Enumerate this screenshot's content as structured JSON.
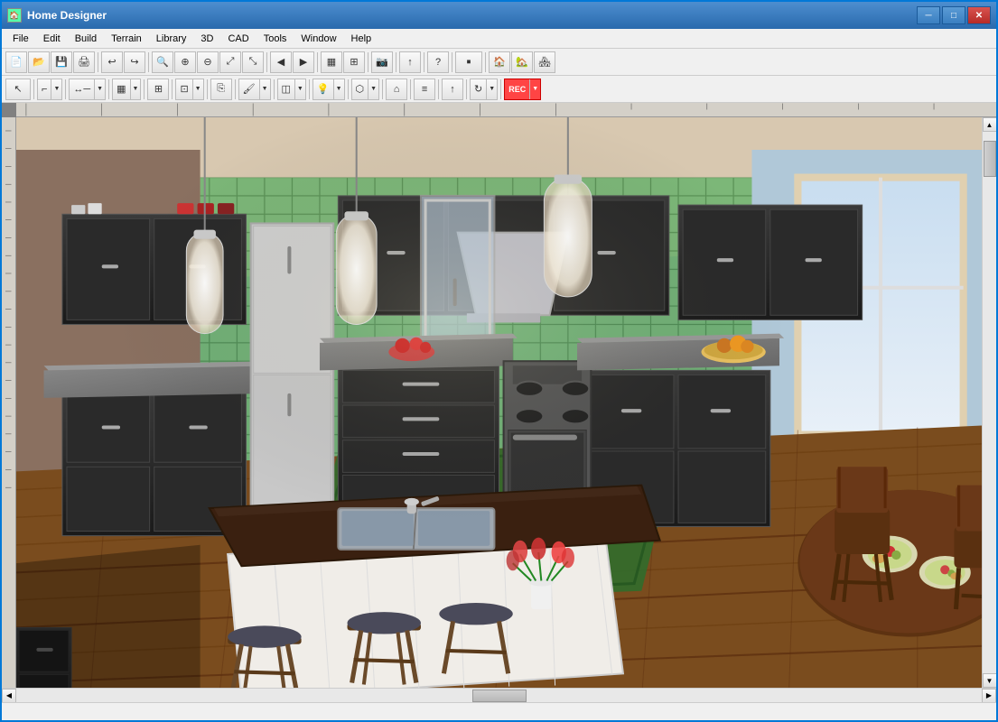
{
  "window": {
    "title": "Home Designer",
    "icon": "🏠"
  },
  "titlebar": {
    "controls": {
      "minimize": "─",
      "maximize": "□",
      "close": "✕"
    }
  },
  "menubar": {
    "items": [
      {
        "id": "file",
        "label": "File"
      },
      {
        "id": "edit",
        "label": "Edit"
      },
      {
        "id": "build",
        "label": "Build"
      },
      {
        "id": "terrain",
        "label": "Terrain"
      },
      {
        "id": "library",
        "label": "Library"
      },
      {
        "id": "3d",
        "label": "3D"
      },
      {
        "id": "cad",
        "label": "CAD"
      },
      {
        "id": "tools",
        "label": "Tools"
      },
      {
        "id": "window",
        "label": "Window"
      },
      {
        "id": "help",
        "label": "Help"
      }
    ]
  },
  "toolbar1": {
    "buttons": [
      {
        "id": "new",
        "icon": "📄",
        "tooltip": "New"
      },
      {
        "id": "open",
        "icon": "📂",
        "tooltip": "Open"
      },
      {
        "id": "save",
        "icon": "💾",
        "tooltip": "Save"
      },
      {
        "id": "print",
        "icon": "🖨",
        "tooltip": "Print"
      },
      {
        "id": "undo",
        "icon": "↩",
        "tooltip": "Undo"
      },
      {
        "id": "redo",
        "icon": "↪",
        "tooltip": "Redo"
      },
      {
        "id": "zoom-in-btn",
        "icon": "🔍",
        "tooltip": "Zoom In"
      },
      {
        "id": "zoom-in2",
        "icon": "⊕",
        "tooltip": "Zoom In"
      },
      {
        "id": "zoom-out",
        "icon": "⊖",
        "tooltip": "Zoom Out"
      },
      {
        "id": "fit",
        "icon": "⤢",
        "tooltip": "Fit"
      },
      {
        "id": "fill",
        "icon": "⤡",
        "tooltip": "Fill Window"
      },
      {
        "id": "prev-pg",
        "icon": "◀",
        "tooltip": "Previous Page"
      },
      {
        "id": "next-pg",
        "icon": "▶",
        "tooltip": "Next Page"
      },
      {
        "id": "cam1",
        "icon": "📷",
        "tooltip": "Camera 1"
      },
      {
        "id": "cam2",
        "icon": "🏠",
        "tooltip": "Camera 2"
      },
      {
        "id": "cam3",
        "icon": "📸",
        "tooltip": "Camera 3"
      },
      {
        "id": "arrow-up",
        "icon": "↑",
        "tooltip": "Arrow"
      },
      {
        "id": "help-q",
        "icon": "?",
        "tooltip": "Help"
      },
      {
        "id": "render",
        "icon": "🏘",
        "tooltip": "Render"
      },
      {
        "id": "house1",
        "icon": "🏡",
        "tooltip": "House"
      },
      {
        "id": "house2",
        "icon": "🏠",
        "tooltip": "House2"
      }
    ]
  },
  "toolbar2": {
    "buttons": [
      {
        "id": "select",
        "icon": "↖",
        "tooltip": "Select"
      },
      {
        "id": "polyline",
        "icon": "⌐",
        "tooltip": "Polyline"
      },
      {
        "id": "dimension",
        "icon": "↔",
        "tooltip": "Dimension"
      },
      {
        "id": "cabinet",
        "icon": "▦",
        "tooltip": "Cabinet"
      },
      {
        "id": "appliance",
        "icon": "⊞",
        "tooltip": "Appliance"
      },
      {
        "id": "fixture",
        "icon": "⊡",
        "tooltip": "Fixture"
      },
      {
        "id": "copy",
        "icon": "⎘",
        "tooltip": "Copy"
      },
      {
        "id": "paint",
        "icon": "🖌",
        "tooltip": "Paint"
      },
      {
        "id": "texture",
        "icon": "◫",
        "tooltip": "Texture"
      },
      {
        "id": "lighting",
        "icon": "💡",
        "tooltip": "Lighting"
      },
      {
        "id": "object",
        "icon": "⬡",
        "tooltip": "Object"
      },
      {
        "id": "roof",
        "icon": "⌂",
        "tooltip": "Roof"
      },
      {
        "id": "stairs",
        "icon": "≡",
        "tooltip": "Stairs"
      },
      {
        "id": "up-arrow",
        "icon": "↑",
        "tooltip": "Move Up"
      },
      {
        "id": "rotate",
        "icon": "↻",
        "tooltip": "Rotate"
      },
      {
        "id": "rec",
        "icon": "⏺",
        "tooltip": "Record"
      }
    ]
  },
  "statusbar": {
    "text": ""
  }
}
